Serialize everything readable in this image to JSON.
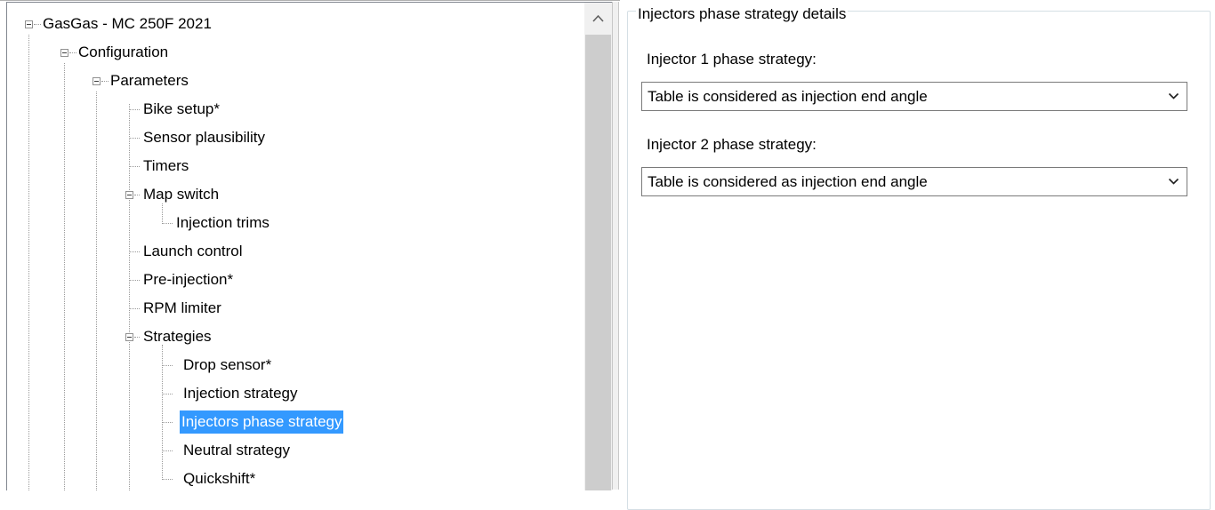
{
  "tree": {
    "root": {
      "label": "GasGas - MC 250F 2021"
    },
    "configuration": {
      "label": "Configuration"
    },
    "parameters": {
      "label": "Parameters"
    },
    "bike_setup": {
      "label": "Bike setup*"
    },
    "sensor_plausibility": {
      "label": "Sensor plausibility"
    },
    "timers": {
      "label": "Timers"
    },
    "map_switch": {
      "label": "Map switch"
    },
    "injection_trims": {
      "label": "Injection trims"
    },
    "launch_control": {
      "label": "Launch control"
    },
    "pre_injection": {
      "label": "Pre-injection*"
    },
    "rpm_limiter": {
      "label": "RPM limiter"
    },
    "strategies": {
      "label": "Strategies"
    },
    "drop_sensor": {
      "label": "Drop sensor*"
    },
    "injection_strategy": {
      "label": "Injection strategy"
    },
    "injectors_phase_strategy": {
      "label": "Injectors phase strategy"
    },
    "neutral_strategy": {
      "label": "Neutral strategy"
    },
    "quickshift": {
      "label": "Quickshift*"
    },
    "selected": "Injectors phase strategy"
  },
  "details": {
    "group_title": "Injectors phase strategy details",
    "injector1": {
      "label": "Injector 1 phase strategy:",
      "value": "Table is considered as injection end angle"
    },
    "injector2": {
      "label": "Injector 2 phase strategy:",
      "value": "Table is considered as injection end angle"
    }
  },
  "colors": {
    "selection": "#3399ff",
    "scrollbar_thumb": "#cdcdcd"
  },
  "icons": {
    "scroll_up": "chevron-up-icon",
    "dropdown": "chevron-down-icon",
    "expander": "minus-box-icon"
  }
}
